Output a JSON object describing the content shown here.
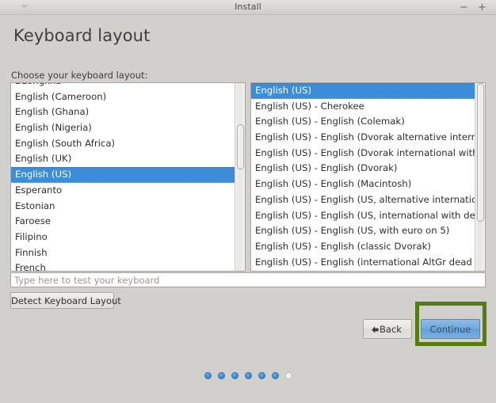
{
  "window": {
    "title": "Install",
    "menu_icon": "chevron-down-icon",
    "minimize_label": "−",
    "maximize_label": "+"
  },
  "page": {
    "title": "Keyboard layout",
    "choose_label": "Choose your keyboard layout:"
  },
  "layout_list": {
    "items": [
      {
        "label": "Dzongkha",
        "selected": false
      },
      {
        "label": "English (Cameroon)",
        "selected": false
      },
      {
        "label": "English (Ghana)",
        "selected": false
      },
      {
        "label": "English (Nigeria)",
        "selected": false
      },
      {
        "label": "English (South Africa)",
        "selected": false
      },
      {
        "label": "English (UK)",
        "selected": false
      },
      {
        "label": "English (US)",
        "selected": true
      },
      {
        "label": "Esperanto",
        "selected": false
      },
      {
        "label": "Estonian",
        "selected": false
      },
      {
        "label": "Faroese",
        "selected": false
      },
      {
        "label": "Filipino",
        "selected": false
      },
      {
        "label": "Finnish",
        "selected": false
      },
      {
        "label": "French",
        "selected": false
      }
    ],
    "scrollbar": {
      "thumb_top_pct": 22,
      "thumb_height_pct": 24
    }
  },
  "variant_list": {
    "items": [
      {
        "label": "English (US)",
        "selected": true
      },
      {
        "label": "English (US) - Cherokee",
        "selected": false
      },
      {
        "label": "English (US) - English (Colemak)",
        "selected": false
      },
      {
        "label": "English (US) - English (Dvorak alternative international no dead keys)",
        "selected": false
      },
      {
        "label": "English (US) - English (Dvorak international with dead keys)",
        "selected": false
      },
      {
        "label": "English (US) - English (Dvorak)",
        "selected": false
      },
      {
        "label": "English (US) - English (Macintosh)",
        "selected": false
      },
      {
        "label": "English (US) - English (US, alternative international)",
        "selected": false
      },
      {
        "label": "English (US) - English (US, international with dead keys)",
        "selected": false
      },
      {
        "label": "English (US) - English (US, with euro on 5)",
        "selected": false
      },
      {
        "label": "English (US) - English (classic Dvorak)",
        "selected": false
      },
      {
        "label": "English (US) - English (international AltGr dead keys)",
        "selected": false
      }
    ],
    "scrollbar": {
      "thumb_top_pct": 0,
      "thumb_height_pct": 74
    }
  },
  "test_input": {
    "placeholder": "Type here to test your keyboard",
    "value": ""
  },
  "buttons": {
    "detect": "Detect Keyboard Layout",
    "back": "Back",
    "back_icon": "arrow-left-icon",
    "continue": "Continue"
  },
  "highlight": {
    "color": "#557d12",
    "target": "continue-button"
  },
  "progress": {
    "total": 7,
    "completed": 6,
    "states": [
      "on",
      "on",
      "on",
      "on",
      "on",
      "on",
      "off"
    ]
  },
  "colors": {
    "selection_blue": "#3c8cd8",
    "continue_blue": "#6ea8dd",
    "window_bg": "#d2d0cd",
    "highlight_green": "#557d12"
  }
}
